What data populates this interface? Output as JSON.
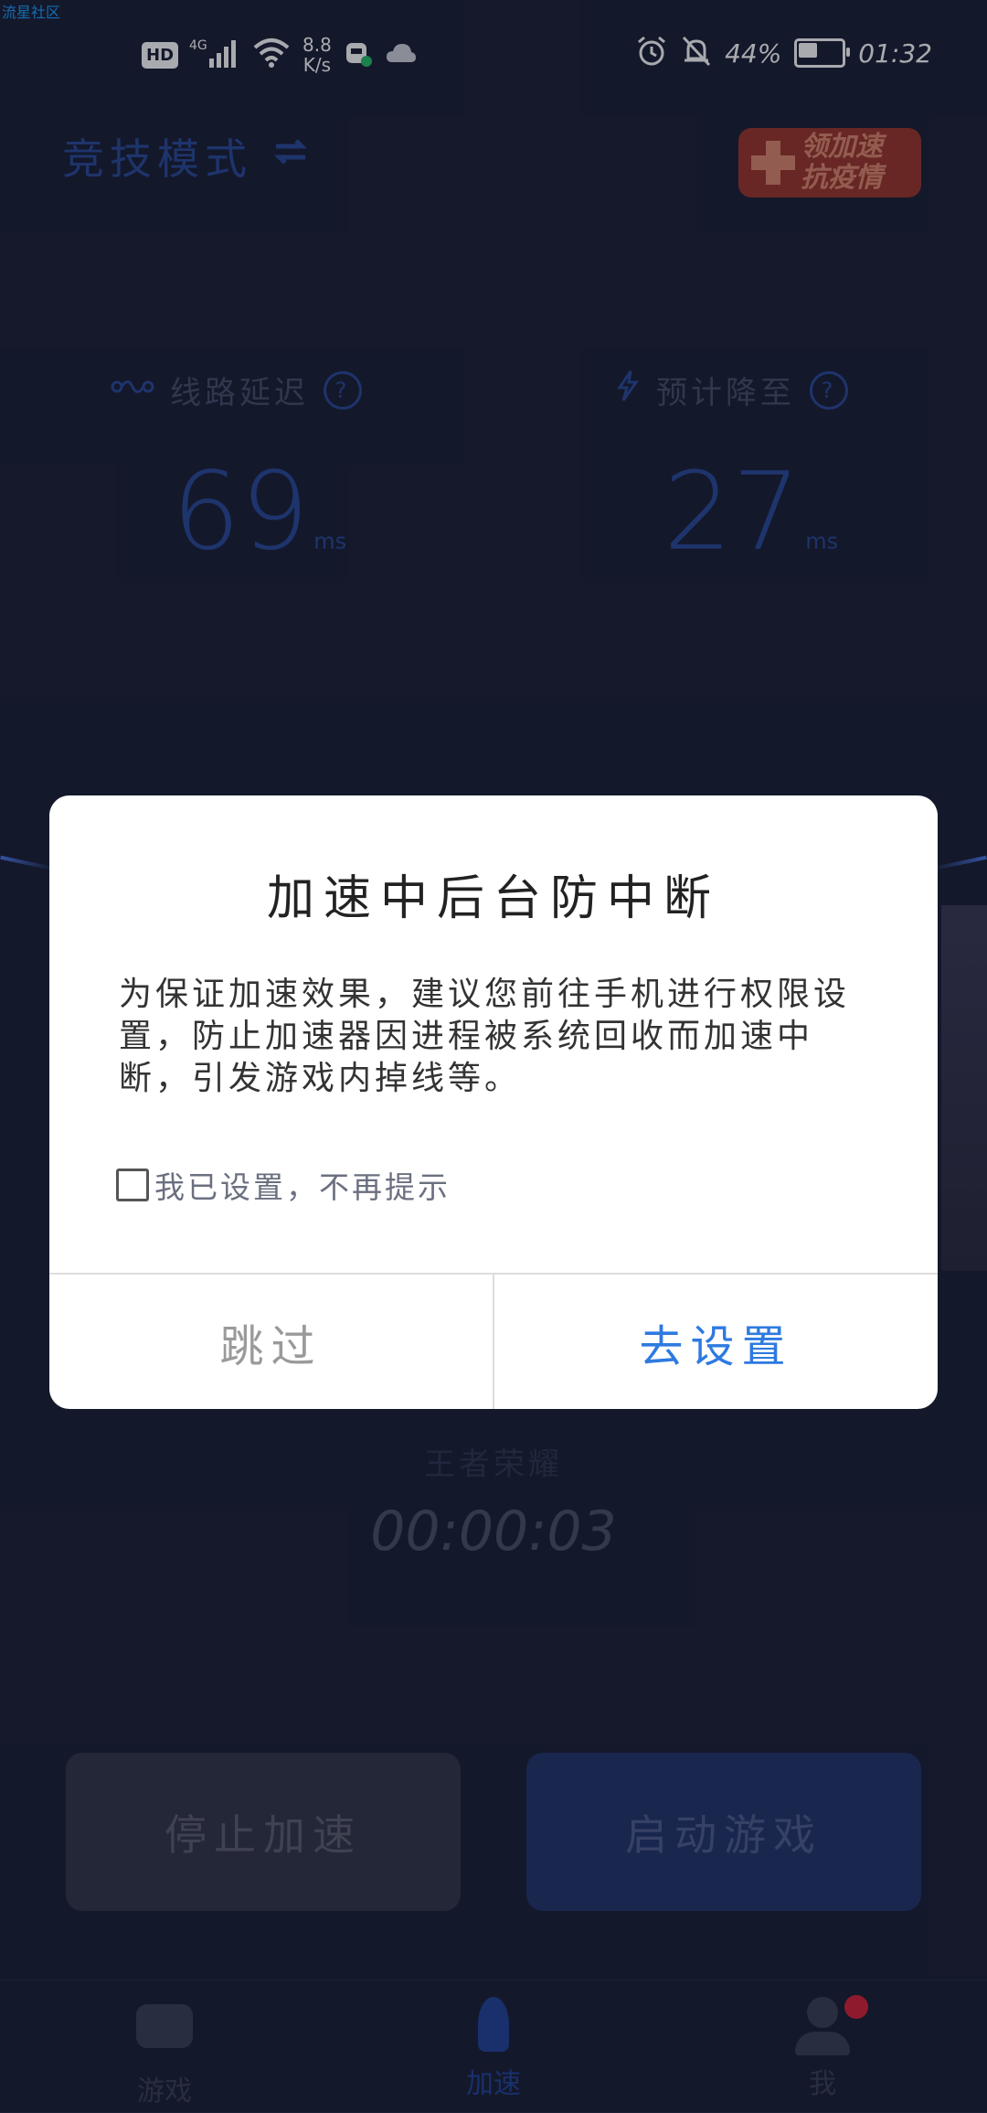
{
  "watermark": "流星社区",
  "status_bar": {
    "network": "4G",
    "speed_value": "8.8",
    "speed_unit": "K/s",
    "battery_percent_label": "44%",
    "battery_level": 0.44,
    "time": "01:32"
  },
  "header": {
    "mode_label": "竞技模式",
    "promo_line1": "领加速",
    "promo_line2": "抗疫情"
  },
  "stats": {
    "latency_label": "线路延迟",
    "latency_value": "69",
    "latency_unit": "ms",
    "expected_label": "预计降至",
    "expected_value": "27",
    "expected_unit": "ms",
    "help_glyph": "?"
  },
  "game": {
    "name": "王者荣耀",
    "timer": "00:00:03"
  },
  "actions": {
    "stop_label": "停止加速",
    "launch_label": "启动游戏"
  },
  "tabs": [
    {
      "label": "游戏",
      "icon": "gamepad-icon",
      "color": "#3a3f55"
    },
    {
      "label": "加速",
      "icon": "rocket-icon",
      "color": "#22449a"
    },
    {
      "label": "我",
      "icon": "profile-icon",
      "color": "#3a3f55"
    }
  ],
  "dialog": {
    "title": "加速中后台防中断",
    "body": "为保证加速效果，建议您前往手机进行权限设置，防止加速器因进程被系统回收而加速中断，引发游戏内掉线等。",
    "checkbox_label": "我已设置，不再提示",
    "skip_label": "跳过",
    "go_label": "去设置"
  },
  "colors": {
    "background": "#1b2036",
    "accent": "#2e7ae0",
    "badge": "#d8223a"
  }
}
